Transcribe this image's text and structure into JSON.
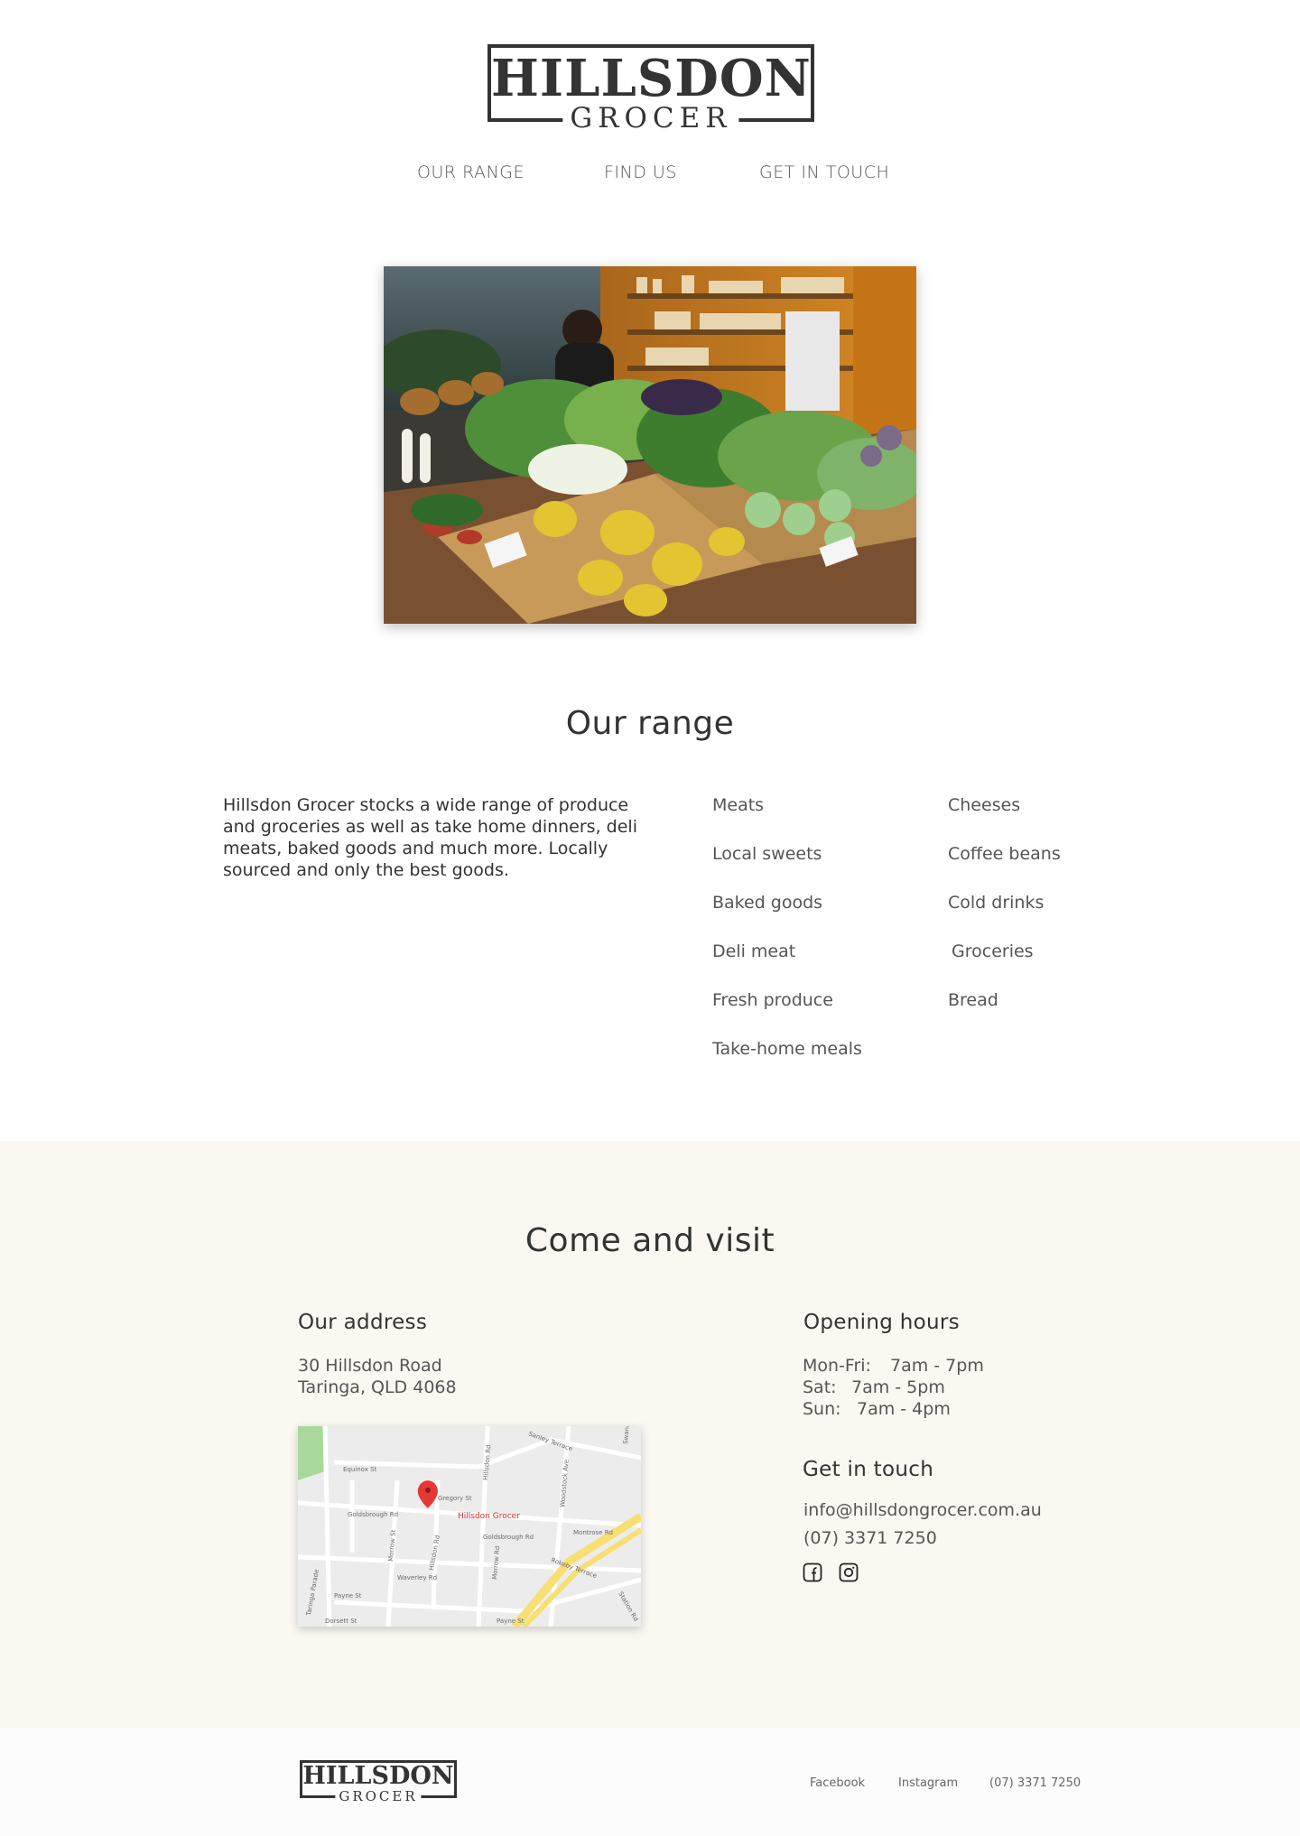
{
  "brand": {
    "name": "HILLSDON",
    "tagline": "GROCER"
  },
  "nav": [
    {
      "label": "OUR RANGE"
    },
    {
      "label": "FIND US"
    },
    {
      "label": "GET IN TOUCH"
    }
  ],
  "hero": {
    "alt": "Fresh produce display"
  },
  "range": {
    "heading": "Our range",
    "description": "Hillsdon Grocer stocks a wide range of produce and groceries as well as take home dinners, deli meats, baked goods and much more. Locally sourced and only the best goods.",
    "column1": [
      "Meats",
      "Local sweets",
      "Baked goods",
      "Deli meat",
      "Fresh produce",
      "Take-home meals"
    ],
    "column2": [
      "Cheeses",
      "Coffee beans",
      "Cold drinks",
      "Groceries",
      "Bread"
    ]
  },
  "visit": {
    "heading": "Come and visit",
    "address_heading": "Our address",
    "address_line1": "30 Hillsdon Road",
    "address_line2": "Taringa, QLD 4068",
    "map_pin_label": "Hillsdon Grocer",
    "map_streets": [
      "Equinox St",
      "Gregory St",
      "Goldsbrough Rd",
      "Morrow St",
      "Hillsdon Rd",
      "Waverley Rd",
      "Payne St",
      "Dorsett St",
      "Taringa Parade",
      "Woodstock Ave",
      "Montrose Rd",
      "Rokeby Terrace",
      "Morrow Rd",
      "Swann Rd",
      "Station Rd",
      "Sanley Terrace"
    ],
    "hours_heading": "Opening hours",
    "hours": [
      {
        "day": "Mon-Fri:",
        "time": "7am - 7pm"
      },
      {
        "day": "Sat:",
        "time": "7am - 5pm"
      },
      {
        "day": "Sun:",
        "time": "7am - 4pm"
      }
    ],
    "contact_heading": "Get in touch",
    "email": "info@hillsdongrocer.com.au",
    "phone": "(07) 3371 7250",
    "social_icons": [
      "facebook-icon",
      "instagram-icon"
    ]
  },
  "footer": {
    "links": [
      {
        "label": "Facebook"
      },
      {
        "label": "Instagram"
      },
      {
        "label": "(07) 3371 7250"
      }
    ]
  },
  "colors": {
    "text": "#333333",
    "muted": "#555555",
    "section_bg": "#faf8f1",
    "pin": "#e53935"
  }
}
